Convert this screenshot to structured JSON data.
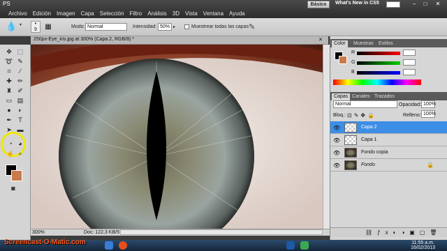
{
  "app": {
    "logo": "PS",
    "workspace": "Básico",
    "whats_new": "What's New in CS5"
  },
  "menu": [
    "Archivo",
    "Edición",
    "Imagen",
    "Capa",
    "Selección",
    "Filtro",
    "Análisis",
    "3D",
    "Vista",
    "Ventana",
    "Ayuda"
  ],
  "options": {
    "brush_size": "9",
    "mode_label": "Modo:",
    "mode_value": "Normal",
    "intensity_label": "Intensidad:",
    "intensity_value": "50%",
    "sample_all_label": "Muestrear todas las capas"
  },
  "document": {
    "tab_title": "250px-Eye_iris.jpg at 300% (Capa 2, RGB/8) *",
    "zoom": "300%",
    "doc_info": "Doc: 122,3 KB/570,8 KB"
  },
  "color_panel": {
    "tabs": [
      "Color",
      "Muestras",
      "Estilos"
    ],
    "channels": [
      {
        "label": "R",
        "value": ""
      },
      {
        "label": "G",
        "value": ""
      },
      {
        "label": "B",
        "value": ""
      }
    ]
  },
  "layers_panel": {
    "tabs": [
      "Capas",
      "Canales",
      "Trazados"
    ],
    "blend_mode": "Normal",
    "opacity_label": "Opacidad:",
    "opacity_value": "100%",
    "lock_label": "Bloq.:",
    "fill_label": "Relleno:",
    "fill_value": "100%",
    "layers": [
      {
        "name": "Capa 2",
        "selected": true
      },
      {
        "name": "Capa 1",
        "selected": false
      },
      {
        "name": "Fondo copia",
        "selected": false
      },
      {
        "name": "Fondo",
        "selected": false,
        "locked": true
      }
    ]
  },
  "taskbar": {
    "watermark": "Screencast-O-Matic.com",
    "time": "11:55 a.m.",
    "date": "16/02/2013"
  }
}
